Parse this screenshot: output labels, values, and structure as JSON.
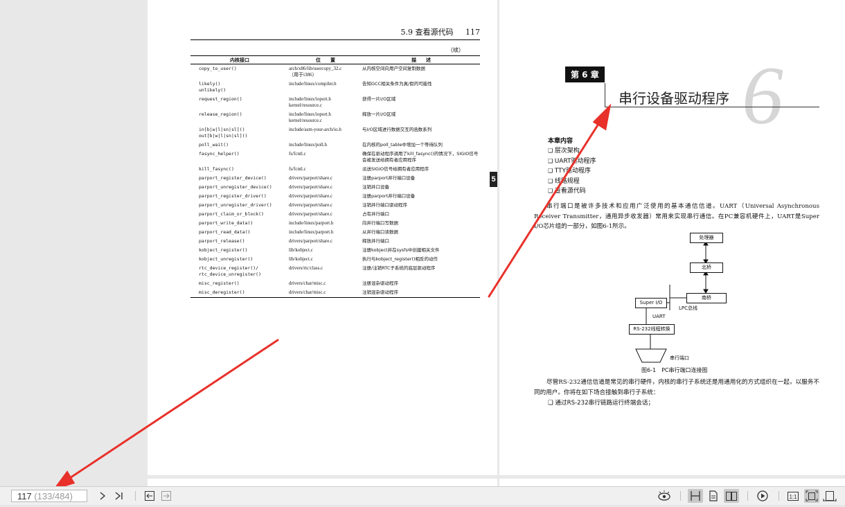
{
  "left_page": {
    "section_ref": "5.9  查看源代码",
    "page_number": "117",
    "continued_label": "（续）",
    "table_headers": [
      "内核接口",
      "位　　置",
      "描　　述"
    ],
    "rows": [
      {
        "api": "copy_to_user()",
        "loc": "arch/x86/lib/usercopy_32.c\n（用于i386）",
        "desc": "从内核空间向用户空间复制数据"
      },
      {
        "api": "likely()\nunlikely()",
        "loc": "include/linux/compiler.h",
        "desc": "告知GCC相关条件为真/假的可能性"
      },
      {
        "api": "request_region()",
        "loc": "include/linux/ioport.h\nkernel/resource.c",
        "desc": "获得一片I/O区域"
      },
      {
        "api": "release_region()",
        "loc": "include/linux/ioport.h\nkernel/resource.c",
        "desc": "释放一片I/O区域"
      },
      {
        "api": "in[b|w|l|sn|sl]()\nout[b|w|l|sn|sl]()",
        "loc": "include/asm-your-arch/io.h",
        "desc": "与I/O区域进行数据交互的函数系列"
      },
      {
        "api": "poll_wait()",
        "loc": "include/linux/poll.h",
        "desc": "在内核的poll_table中增加一个等待队列"
      },
      {
        "api": "fasync_helper()",
        "loc": "fs/fcntl.c",
        "desc": "确保在驱动程序调用了kill_fasync()的情况下，SIGIO信号会被发送给拥有者应用程序"
      },
      {
        "api": "kill_fasync()",
        "loc": "fs/fcntl.c",
        "desc": "派送SIGIO信号给拥有者应用程序"
      },
      {
        "api": "parport_register_device()",
        "loc": "drivers/parport/share.c",
        "desc": "注册parport并行端口设备"
      },
      {
        "api": "parport_unregister_device()",
        "loc": "drivers/parport/share.c",
        "desc": "注销并口设备"
      },
      {
        "api": "parport_register_driver()",
        "loc": "drivers/parport/share.c",
        "desc": "注册parport并行端口设备"
      },
      {
        "api": "parport_unregister_driver()",
        "loc": "drivers/parport/share.c",
        "desc": "注销并行端口驱动程序"
      },
      {
        "api": "parport_claim_or_block()",
        "loc": "drivers/parport/share.c",
        "desc": "占有并行端口"
      },
      {
        "api": "parport_write_data()",
        "loc": "include/linux/parport.h",
        "desc": "向并行端口写数据"
      },
      {
        "api": "parport_read_data()",
        "loc": "include/linux/parport.h",
        "desc": "从并行端口读数据"
      },
      {
        "api": "parport_release()",
        "loc": "drivers/parport/share.c",
        "desc": "释放并行端口"
      },
      {
        "api": "kobject_register()",
        "loc": "lib/kobject.c",
        "desc": "注册kobject并在sysfs中创建相关文件"
      },
      {
        "api": "kobject_unregister()",
        "loc": "lib/kobject.c",
        "desc": "执行与kobject_register()相反的动作"
      },
      {
        "api": "rtc_device_register()/\nrtc_device_unregister()",
        "loc": "drivers/rtc/class.c",
        "desc": "注册/注销RTC子系统的底层驱动程序"
      },
      {
        "api": "misc_register()",
        "loc": "drivers/char/misc.c",
        "desc": "注册混杂驱动程序"
      },
      {
        "api": "misc_deregister()",
        "loc": "drivers/char/misc.c",
        "desc": "注销混杂驱动程序"
      }
    ],
    "thumb_tab": "5"
  },
  "right_page": {
    "chapter_tag": "第 6 章",
    "chapter_title": "串行设备驱动程序",
    "chapter_big_number": "6",
    "toc_title": "本章内容",
    "toc_items": [
      "层次架构",
      "UART驱动程序",
      "TTY驱动程序",
      "线路规程",
      "查看源代码"
    ],
    "para1": "串行端口是被许多技术和应用广泛使用的基本通信信道。UART（Universal Asynchronous Receiver Transmitter，通用异步收发器）常用来实现串行通信。在PC兼容机硬件上，UART是Super I/O芯片组的一部分，如图6-1所示。",
    "figure": {
      "cpu": "处理器",
      "northbridge": "北桥",
      "southbridge": "南桥",
      "superio": "Super I/O",
      "lpc": "LPC总线",
      "uart": "UART",
      "rs232": "RS-232线程转换",
      "serial_port": "串行端口",
      "caption": "图6-1　PC串行端口连接图"
    },
    "para2": "尽管RS-232通信信道是常见的串行硬件，内核的串行子系统还是用通用化的方式组织在一起，以服务不同的用户。你将在如下场合接触到串行子系统：",
    "bullet1": "❑ 通过RS-232串行链路运行终端会话；"
  },
  "toolbar": {
    "current_page": "117",
    "page_range": " (133/484)",
    "icons": [
      "next-page-icon",
      "last-page-icon",
      "back-icon",
      "forward-icon",
      "eye-icon",
      "continuous-scroll-icon",
      "single-page-icon",
      "two-page-icon",
      "play-icon",
      "actual-size-icon",
      "fit-page-icon",
      "fit-width-icon"
    ]
  },
  "annotation_color": "#e8312a"
}
